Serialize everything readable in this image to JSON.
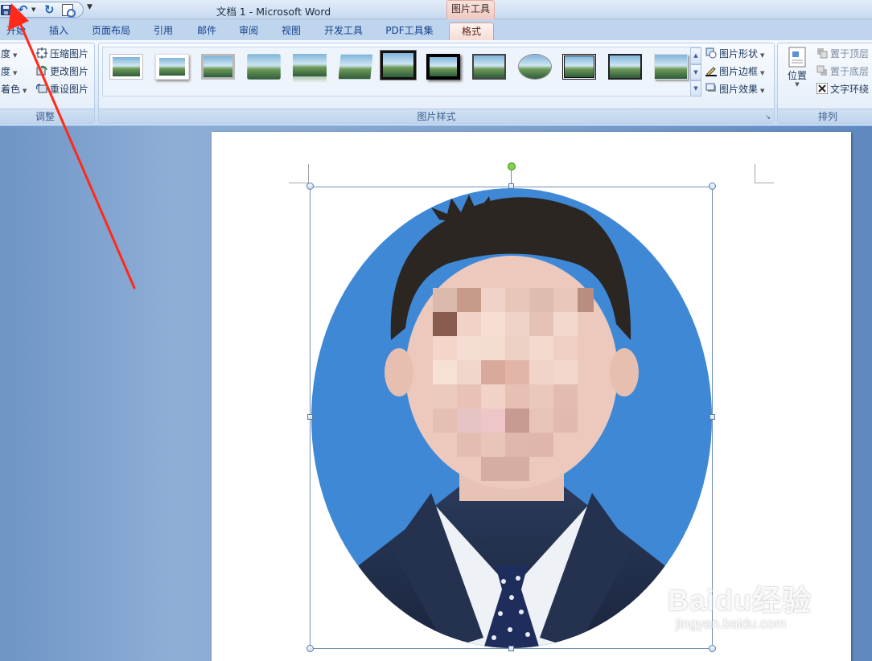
{
  "window": {
    "title": "文档 1 - Microsoft Word",
    "context_tab_title": "图片工具"
  },
  "quick_access": {
    "icons": [
      "save-icon",
      "undo-icon",
      "redo-icon",
      "print-preview-icon",
      "customize-icon"
    ]
  },
  "tabs": [
    {
      "label": "开始",
      "active": false
    },
    {
      "label": "插入",
      "active": false
    },
    {
      "label": "页面布局",
      "active": false
    },
    {
      "label": "引用",
      "active": false
    },
    {
      "label": "邮件",
      "active": false
    },
    {
      "label": "审阅",
      "active": false
    },
    {
      "label": "视图",
      "active": false
    },
    {
      "label": "开发工具",
      "active": false
    },
    {
      "label": "PDF工具集",
      "active": false
    },
    {
      "label": "格式",
      "active": true
    }
  ],
  "ribbon": {
    "adjust": {
      "label": "调整",
      "left_items": [
        "度",
        "度",
        "着色"
      ],
      "compress": "压缩图片",
      "change": "更改图片",
      "reset": "重设图片"
    },
    "picture_styles": {
      "label": "图片样式",
      "shape": "图片形状",
      "border": "图片边框",
      "effects": "图片效果"
    },
    "arrange": {
      "label": "排列",
      "position": "位置",
      "bring_front": "置于顶层",
      "send_back": "置于底层",
      "text_wrap": "文字环绕"
    }
  },
  "watermark": {
    "brand": "Baidu经验",
    "url": "jingyan.baidu.com"
  },
  "colors": {
    "annotation_arrow": "#ff2a1a",
    "photo_background": "#3f88d6",
    "active_tab": "#f6dcd6"
  }
}
